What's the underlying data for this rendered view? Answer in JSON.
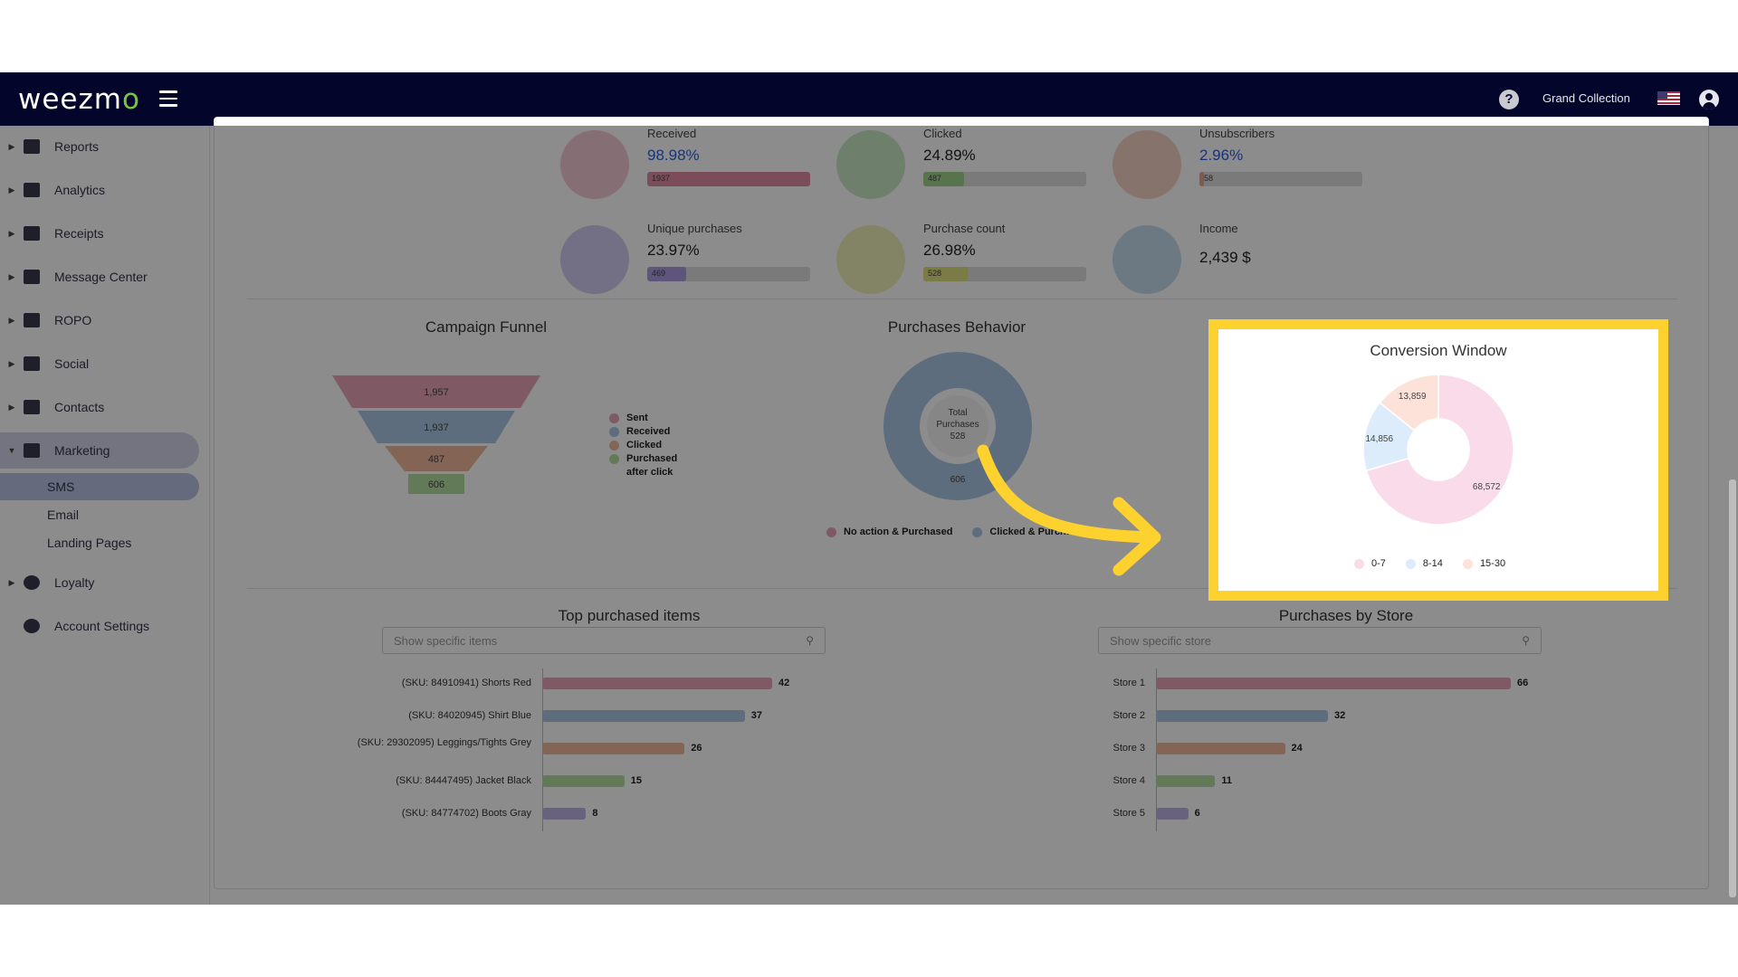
{
  "topbar": {
    "logo_main": "weezm",
    "logo_o": "o",
    "help_glyph": "?",
    "user_name": "Grand Collection",
    "icons": [
      "menu-icon",
      "help-icon",
      "us-flag-icon",
      "user-avatar-icon"
    ]
  },
  "sidebar": {
    "items": [
      {
        "label": "Reports",
        "icon": "dashboard-icon"
      },
      {
        "label": "Analytics",
        "icon": "analytics-icon"
      },
      {
        "label": "Receipts",
        "icon": "receipt-icon"
      },
      {
        "label": "Message Center",
        "icon": "message-icon"
      },
      {
        "label": "ROPO",
        "icon": "infinity-icon"
      },
      {
        "label": "Social",
        "icon": "people-icon"
      },
      {
        "label": "Contacts",
        "icon": "contacts-icon"
      },
      {
        "label": "Marketing",
        "icon": "megaphone-icon"
      }
    ],
    "subitems": [
      "SMS",
      "Email",
      "Landing Pages"
    ],
    "bottom_items": [
      {
        "label": "Loyalty",
        "icon": "tag-icon"
      },
      {
        "label": "Account Settings",
        "icon": "gear-icon"
      }
    ]
  },
  "kpis": [
    {
      "label": "Received",
      "value": "98.98%",
      "bar_value": "1937",
      "fraction": 1.0,
      "color": "#e08aa2",
      "icon": "paper-plane-icon",
      "icon_bg": "#f4c9d6",
      "blue": true
    },
    {
      "label": "Clicked",
      "value": "24.89%",
      "bar_value": "487",
      "fraction": 0.25,
      "color": "#9fd48d",
      "icon": "hand-click-icon",
      "icon_bg": "#c9e9c3",
      "blue": false
    },
    {
      "label": "Unsubscribers",
      "value": "2.96%",
      "bar_value": "58",
      "fraction": 0.03,
      "color": "#e9a08a",
      "icon": "user-remove-icon",
      "icon_bg": "#f5d2c4",
      "blue": true
    },
    {
      "label": "Unique purchases",
      "value": "23.97%",
      "bar_value": "469",
      "fraction": 0.24,
      "color": "#a99be0",
      "icon": "cart-icon",
      "icon_bg": "#d2cbf0",
      "blue": false
    },
    {
      "label": "Purchase count",
      "value": "26.98%",
      "bar_value": "528",
      "fraction": 0.27,
      "color": "#dfe07e",
      "icon": "cart-icon",
      "icon_bg": "#eff0b8",
      "blue": false
    },
    {
      "label": "Income",
      "value": "2,439 $",
      "bar_value": "",
      "fraction": 0,
      "color": "",
      "icon": "money-bag-icon",
      "icon_bg": "#c6dded",
      "blue": false
    }
  ],
  "funnel": {
    "title": "Campaign Funnel",
    "steps": [
      "1,957",
      "1,937",
      "487",
      "606"
    ],
    "legend": [
      "Sent",
      "Received",
      "Clicked",
      "Purchased after click"
    ],
    "colors": [
      "#e8a3b7",
      "#a9c7e3",
      "#f1b79c",
      "#b3df9e"
    ]
  },
  "behavior": {
    "title": "Purchases Behavior",
    "center_lines": [
      "Total",
      "Purchases",
      "528"
    ],
    "value_label": "606",
    "legend": [
      "No action & Purchased",
      "Clicked & Purchased"
    ],
    "colors": [
      "#e8a3b7",
      "#a9c7e3"
    ]
  },
  "chart_data": [
    {
      "type": "pie",
      "title": "Conversion Window",
      "categories": [
        "0-7",
        "8-14",
        "15-30"
      ],
      "values": [
        68572,
        14856,
        13859
      ],
      "labels": [
        "68,572",
        "14,856",
        "13,859"
      ],
      "colors": [
        "#f9dbea",
        "#dcecfa",
        "#fde2d9"
      ],
      "legend": "bottom"
    },
    {
      "type": "bar",
      "title": "Top purchased items",
      "categories": [
        "(SKU: 84910941) Shorts Red",
        "(SKU: 84020945) Shirt Blue",
        "(SKU: 29302095) Leggings/Tights Grey",
        "(SKU: 84447495) Jacket Black",
        "(SKU: 84774702) Boots Gray"
      ],
      "values": [
        42,
        37,
        26,
        15,
        8
      ],
      "colors": [
        "#e8a3b7",
        "#a9c7e3",
        "#f1b79c",
        "#b3df9e",
        "#bdb2e8"
      ]
    },
    {
      "type": "bar",
      "title": "Purchases by Store",
      "categories": [
        "Store 1",
        "Store 2",
        "Store 3",
        "Store 4",
        "Store 5"
      ],
      "values": [
        66,
        32,
        24,
        11,
        6
      ],
      "colors": [
        "#e8a3b7",
        "#a9c7e3",
        "#f1b79c",
        "#b3df9e",
        "#bdb2e8"
      ]
    }
  ],
  "items_search": {
    "placeholder": "Show specific items"
  },
  "store_search": {
    "placeholder": "Show specific store"
  },
  "highlight_color": "#fdd22f"
}
